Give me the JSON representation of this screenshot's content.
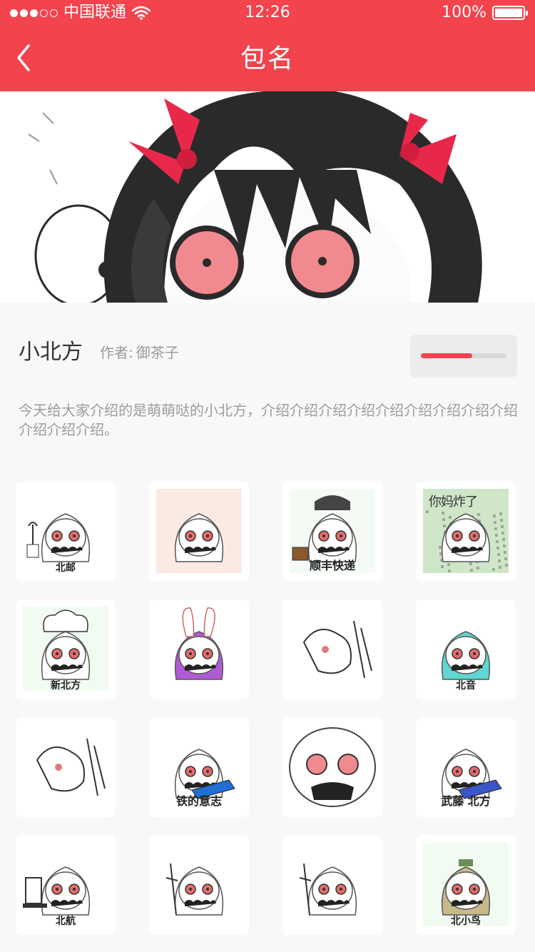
{
  "status_bar": {
    "carrier": "中国联通",
    "time": "12:26",
    "battery": "100%",
    "signal_dots_filled": 3,
    "signal_dots_total": 5
  },
  "nav": {
    "title": "包名",
    "back_icon": "chevron-left-icon"
  },
  "banner": {
    "image": "anime-girl-twin-tails-banner"
  },
  "package": {
    "name": "小北方",
    "author_label": "作者:",
    "author": "御茶子",
    "download_progress": 0.6,
    "description": "今天给大家介绍的是萌萌哒的小北方，介绍介绍介绍介绍介绍介绍介绍介绍介绍介绍介绍介绍。"
  },
  "stickers": [
    {
      "caption": "北邮",
      "icon": "antenna-icon"
    },
    {
      "caption": "",
      "icon": "comic-panel-icon"
    },
    {
      "caption": "顺丰快递",
      "icon": "delivery-box-icon"
    },
    {
      "caption": "",
      "icon": "noise-filter-icon",
      "top_text": "你妈炸了"
    },
    {
      "caption": "新北方",
      "icon": "chef-hat-icon"
    },
    {
      "caption": "",
      "icon": "bunny-ears-icon"
    },
    {
      "caption": "",
      "icon": "sketch-icon"
    },
    {
      "caption": "北音",
      "icon": "teal-hair-icon"
    },
    {
      "caption": "",
      "icon": "running-figure-icon"
    },
    {
      "caption": "铁的意志",
      "icon": "card-icon"
    },
    {
      "caption": "",
      "icon": "closeup-face-icon"
    },
    {
      "caption": "武藤 北方",
      "icon": "duel-card-icon"
    },
    {
      "caption": "北航",
      "icon": "computer-icon"
    },
    {
      "caption": "",
      "icon": "pointing-figure-icon"
    },
    {
      "caption": "",
      "icon": "pointing-figure-icon"
    },
    {
      "caption": "北小鸟",
      "icon": "green-hair-icon"
    }
  ],
  "colors": {
    "accent": "#f3434d",
    "background": "#f8f8f8"
  }
}
